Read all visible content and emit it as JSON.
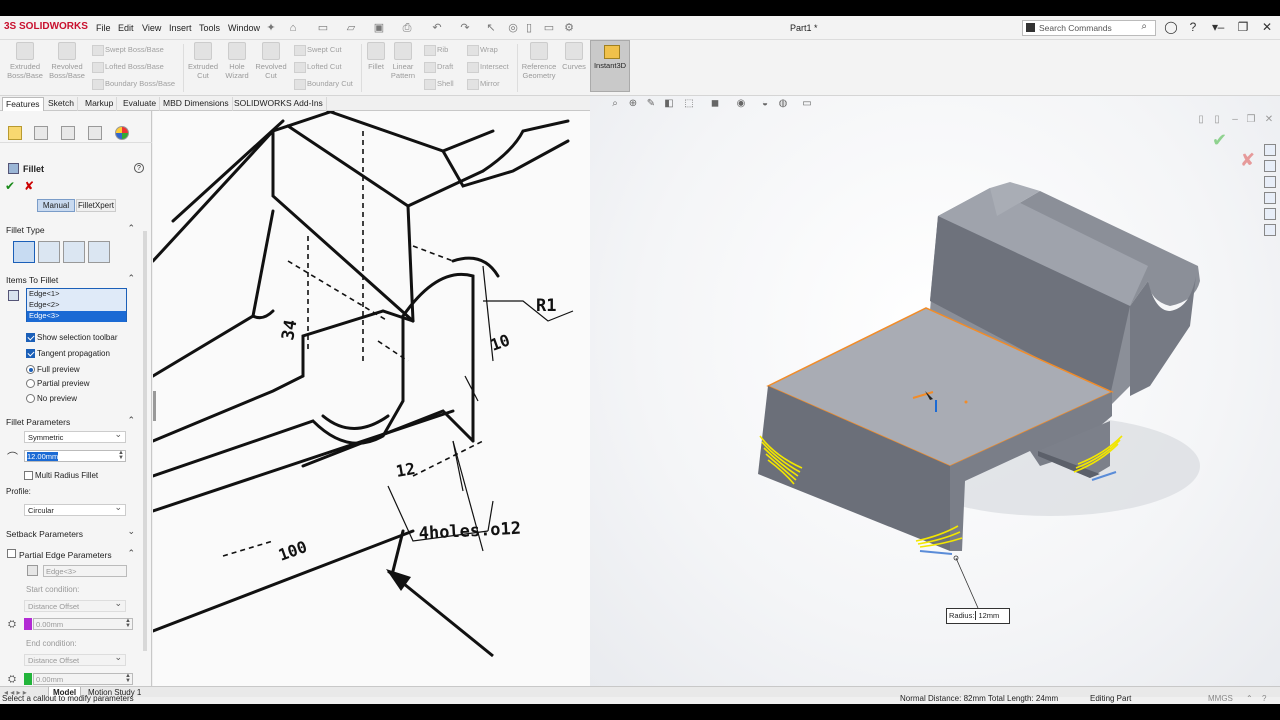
{
  "app": {
    "brand": "SOLIDWORKS",
    "doc_title": "Part1 *"
  },
  "menu": [
    "File",
    "Edit",
    "View",
    "Insert",
    "Tools",
    "Window"
  ],
  "search": {
    "placeholder": "Search Commands"
  },
  "ribbon": {
    "big": [
      {
        "label": "Extruded\nBoss/Base"
      },
      {
        "label": "Revolved\nBoss/Base"
      },
      {
        "label": "Extruded\nCut"
      },
      {
        "label": "Hole\nWizard"
      },
      {
        "label": "Revolved\nCut"
      },
      {
        "label": "Fillet"
      },
      {
        "label": "Linear\nPattern"
      },
      {
        "label": "Reference\nGeometry"
      },
      {
        "label": "Curves"
      }
    ],
    "small": [
      "Swept Boss/Base",
      "Lofted Boss/Base",
      "Boundary Boss/Base",
      "Swept Cut",
      "Lofted Cut",
      "Boundary Cut",
      "Rib",
      "Draft",
      "Shell",
      "Wrap",
      "Intersect",
      "Mirror"
    ],
    "instant3d": "Instant3D"
  },
  "tabs": [
    "Features",
    "Sketch",
    "Markup",
    "Evaluate",
    "MBD Dimensions",
    "SOLIDWORKS Add-Ins"
  ],
  "pm": {
    "title": "Fillet",
    "modes": [
      "Manual",
      "FilletXpert"
    ],
    "fillet_type_header": "Fillet Type",
    "items_header": "Items To Fillet",
    "edges": [
      "Edge<1>",
      "Edge<2>",
      "Edge<3>"
    ],
    "show_toolbar": "Show selection toolbar",
    "tangent": "Tangent propagation",
    "full_preview": "Full preview",
    "partial_preview": "Partial preview",
    "no_preview": "No preview",
    "params_header": "Fillet Parameters",
    "symmetric": "Symmetric",
    "radius": "12.00mm",
    "multi_radius": "Multi Radius Fillet",
    "profile_label": "Profile:",
    "profile": "Circular",
    "setback_header": "Setback Parameters",
    "partial_header": "Partial Edge Parameters",
    "partial_edge": "Edge<3>",
    "start_condition": "Start condition:",
    "start_dd": "Distance Offset",
    "start_val": "0.00mm",
    "end_condition": "End condition:",
    "end_dd": "Distance Offset",
    "end_val": "0.00mm"
  },
  "drawing": {
    "r_label": "R1",
    "dim_10": "10",
    "dim_34": "34",
    "dim_12": "12",
    "holes": "4holes.o12",
    "dim_100": "100"
  },
  "callout": {
    "key": "Radius:",
    "value": "12mm"
  },
  "bottom_tabs": [
    "Model",
    "Motion Study 1"
  ],
  "status": {
    "left": "Select a callout to modify parameters",
    "measure": "Normal Distance: 82mm Total Length: 24mm",
    "mode": "Editing Part",
    "units": "MMGS"
  },
  "colors": {
    "selection": "#1b6ad4",
    "edge_highlight": "#f28c28",
    "fillet_preview": "#f2e600",
    "part": "#8f939c"
  }
}
